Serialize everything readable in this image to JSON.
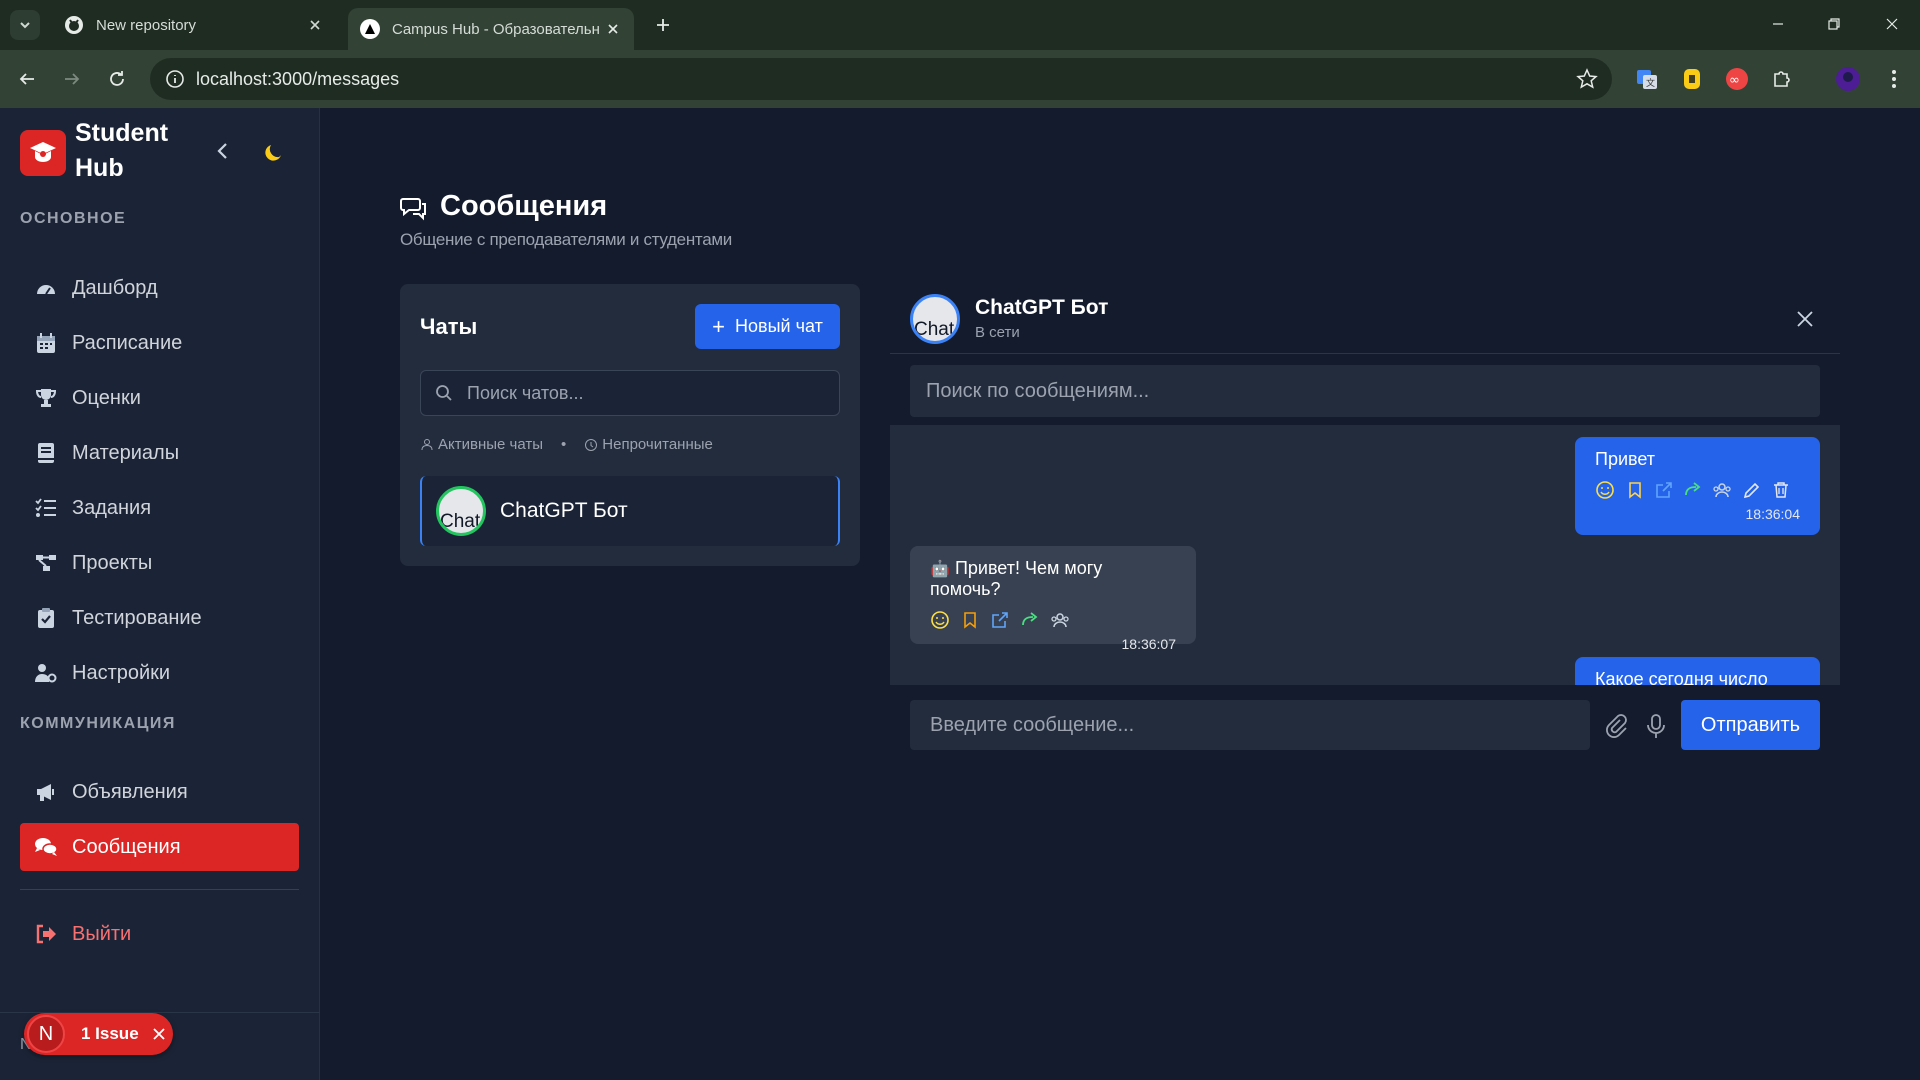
{
  "browser": {
    "tabs": [
      {
        "title": "New repository",
        "icon": "github-icon"
      },
      {
        "title": "Campus Hub - Образовательн",
        "icon": "triangle-logo-icon"
      }
    ],
    "url": "localhost:3000/messages"
  },
  "sidebar": {
    "brand": "Student Hub",
    "section_main": "ОСНОВНОЕ",
    "section_comm": "КОММУНИКАЦИЯ",
    "items": [
      {
        "label": "Дашборд",
        "icon": "gauge-icon"
      },
      {
        "label": "Расписание",
        "icon": "calendar-icon"
      },
      {
        "label": "Оценки",
        "icon": "trophy-icon"
      },
      {
        "label": "Материалы",
        "icon": "book-icon"
      },
      {
        "label": "Задания",
        "icon": "list-check-icon"
      },
      {
        "label": "Проекты",
        "icon": "project-diagram-icon"
      },
      {
        "label": "Тестирование",
        "icon": "clipboard-check-icon"
      },
      {
        "label": "Настройки",
        "icon": "user-gear-icon"
      }
    ],
    "comm_items": [
      {
        "label": "Объявления",
        "icon": "megaphone-icon"
      },
      {
        "label": "Сообщения",
        "icon": "comments-icon",
        "active": true
      }
    ],
    "logout": "Выйти",
    "issue_badge": {
      "letter": "N",
      "text": "1 Issue"
    },
    "truncated_text": "N"
  },
  "page": {
    "title": "Сообщения",
    "subtitle": "Общение с преподавателями и студентами"
  },
  "chats": {
    "title": "Чаты",
    "new_chat": "Новый чат",
    "search_placeholder": "Поиск чатов...",
    "filter_active": "Активные чаты",
    "filter_separator": "•",
    "filter_unread": "Непрочитанные",
    "list": [
      {
        "name": "ChatGPT Бот",
        "avatar_alt": "Chat"
      }
    ]
  },
  "conversation": {
    "name": "ChatGPT Бот",
    "status": "В сети",
    "avatar_alt": "Chat",
    "search_placeholder": "Поиск по сообщениям...",
    "messages": [
      {
        "direction": "out",
        "text": "Привет",
        "time": "18:36:04"
      },
      {
        "direction": "in",
        "text": "Привет! Чем могу помочь?",
        "time": "18:36:07",
        "emoji": "🤖"
      },
      {
        "direction": "out",
        "text": "Какое сегодня число",
        "time": ""
      }
    ],
    "composer_placeholder": "Введите сообщение...",
    "send": "Отправить"
  },
  "colors": {
    "accent_red": "#dc2626",
    "accent_blue": "#2563eb",
    "bg": "#141b2d",
    "online_green": "#22c55e"
  }
}
